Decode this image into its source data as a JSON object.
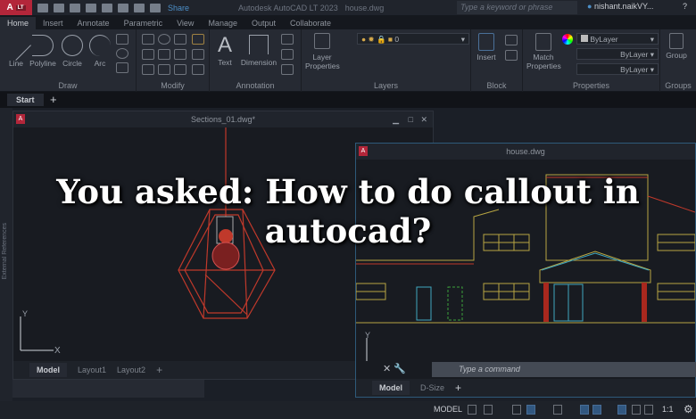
{
  "titlebar": {
    "logo": "A",
    "edition": "LT",
    "share": "Share",
    "app_title": "Autodesk AutoCAD LT 2023",
    "file": "house.dwg",
    "search_placeholder": "Type a keyword or phrase",
    "user": "nishant.naikVY..."
  },
  "ribbon_tabs": [
    "Home",
    "Insert",
    "Annotate",
    "Parametric",
    "View",
    "Manage",
    "Output",
    "Collaborate"
  ],
  "panels": {
    "draw": {
      "label": "Draw",
      "tools": [
        "Line",
        "Polyline",
        "Circle",
        "Arc"
      ]
    },
    "modify": {
      "label": "Modify"
    },
    "annotation": {
      "label": "Annotation",
      "tools": [
        "Text",
        "Dimension"
      ]
    },
    "layers": {
      "label": "Layers",
      "tool": "Layer Properties",
      "layer_value": "0"
    },
    "block": {
      "label": "Block",
      "tool": "Insert"
    },
    "properties": {
      "label": "Properties",
      "tool": "Match Properties",
      "color": "ByLayer",
      "linetype": "ByLayer",
      "lineweight": "ByLayer"
    },
    "groups": {
      "label": "Groups",
      "tool": "Group"
    }
  },
  "doc_tabs": {
    "start": "Start",
    "add": "+"
  },
  "window_left": {
    "title": "Sections_01.dwg*",
    "side_palette": "External References",
    "layout_tabs": [
      "Model",
      "Layout1",
      "Layout2"
    ],
    "add": "+",
    "axis_x": "X",
    "axis_y": "Y"
  },
  "window_right": {
    "title": "house.dwg",
    "command_placeholder": "Type a command",
    "layout_tabs": [
      "Model",
      "D-Size"
    ],
    "add": "+",
    "axis_y": "Y"
  },
  "status": {
    "model": "MODEL",
    "scale": "1:1"
  },
  "headline": {
    "line1": "You asked: How to do callout in",
    "line2": "autocad?"
  },
  "colors": {
    "accent": "#b3263a",
    "drawing_red": "#c0392b",
    "drawing_yellow": "#b8a642",
    "drawing_cyan": "#3fa7c0",
    "drawing_green": "#3ca03c"
  }
}
